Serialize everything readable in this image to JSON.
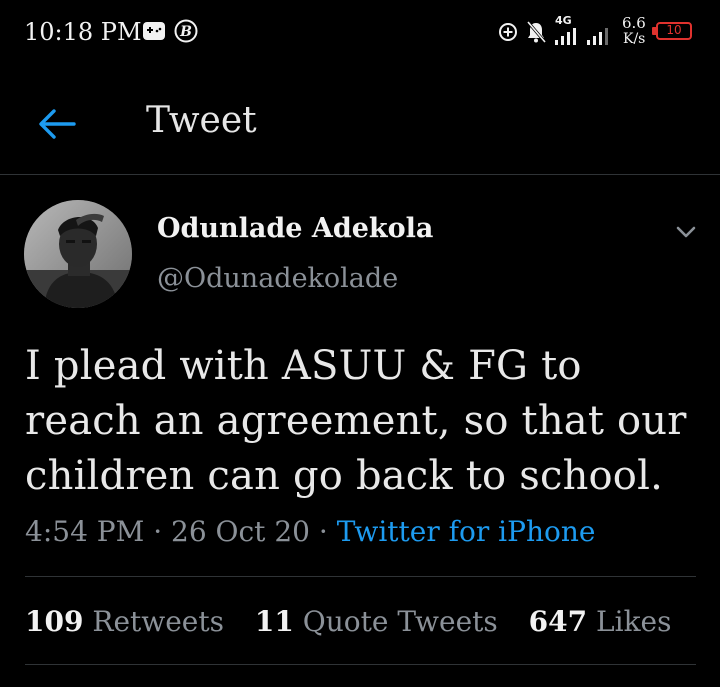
{
  "status_bar": {
    "time": "10:18 PM",
    "network_label": "4G",
    "speed_value": "6.6",
    "speed_unit": "K/s",
    "battery": "10",
    "icons": [
      "game-controller-icon",
      "b-circle-icon",
      "add-circle-icon",
      "bell-muted-icon",
      "signal-icon",
      "signal-icon",
      "battery-icon"
    ]
  },
  "header": {
    "back_icon": "arrow-left-icon",
    "title": "Tweet"
  },
  "tweet": {
    "display_name": "Odunlade Adekola",
    "handle": "@Odunadekolade",
    "text": "I plead with ASUU & FG to reach an agreement, so that our children can go back to school.",
    "time": "4:54 PM",
    "separator": "·",
    "date": "26 Oct 20",
    "source": "Twitter for iPhone",
    "more_icon": "chevron-down-icon"
  },
  "stats": {
    "retweets_count": "109",
    "retweets_label": "Retweets",
    "quotes_count": "11",
    "quotes_label": "Quote Tweets",
    "likes_count": "647",
    "likes_label": "Likes"
  },
  "colors": {
    "background": "#000000",
    "accent": "#1d9bf0",
    "secondary_text": "#8b9198",
    "divider": "#2f3336",
    "battery_low": "#e0322e"
  }
}
